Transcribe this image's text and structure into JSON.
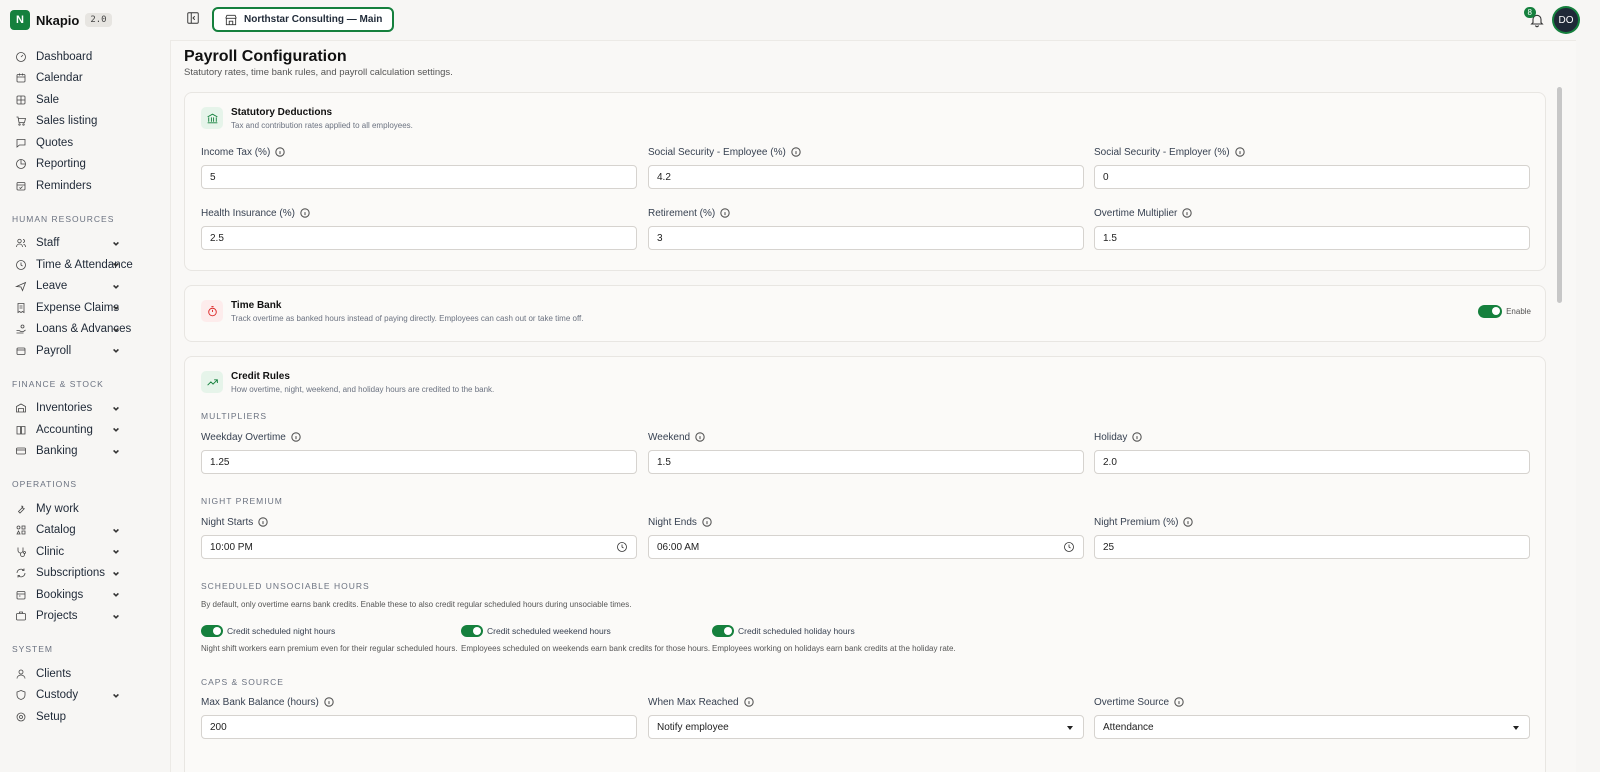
{
  "brand": {
    "name": "Nkapio",
    "version": "2.0"
  },
  "header": {
    "org": "Northstar Consulting — Main",
    "notif_count": "8",
    "avatar": "DO"
  },
  "nav": {
    "main": [
      {
        "label": "Dashboard",
        "icon": "gauge-icon"
      },
      {
        "label": "Calendar",
        "icon": "calendar-icon"
      },
      {
        "label": "Sale",
        "icon": "grid-icon"
      },
      {
        "label": "Sales listing",
        "icon": "cart-icon"
      },
      {
        "label": "Quotes",
        "icon": "message-icon"
      },
      {
        "label": "Reporting",
        "icon": "pie-icon"
      },
      {
        "label": "Reminders",
        "icon": "calendar-check-icon"
      }
    ],
    "hr_title": "HUMAN RESOURCES",
    "hr": [
      {
        "label": "Staff"
      },
      {
        "label": "Time & Attendance"
      },
      {
        "label": "Leave"
      },
      {
        "label": "Expense Claims"
      },
      {
        "label": "Loans & Advances"
      },
      {
        "label": "Payroll"
      }
    ],
    "fin_title": "FINANCE & STOCK",
    "fin": [
      {
        "label": "Inventories"
      },
      {
        "label": "Accounting"
      },
      {
        "label": "Banking"
      }
    ],
    "ops_title": "OPERATIONS",
    "ops": [
      {
        "label": "My work"
      },
      {
        "label": "Catalog"
      },
      {
        "label": "Clinic"
      },
      {
        "label": "Subscriptions"
      },
      {
        "label": "Bookings"
      },
      {
        "label": "Projects"
      }
    ],
    "sys_title": "SYSTEM",
    "sys": [
      {
        "label": "Clients"
      },
      {
        "label": "Custody"
      },
      {
        "label": "Setup"
      }
    ]
  },
  "page": {
    "title": "Payroll Configuration",
    "subtitle": "Statutory rates, time bank rules, and payroll calculation settings."
  },
  "statutory": {
    "title": "Statutory Deductions",
    "desc": "Tax and contribution rates applied to all employees.",
    "fields": [
      {
        "label": "Income Tax (%)",
        "value": "5"
      },
      {
        "label": "Social Security - Employee (%)",
        "value": "4.2"
      },
      {
        "label": "Social Security - Employer (%)",
        "value": "0"
      },
      {
        "label": "Health Insurance (%)",
        "value": "2.5"
      },
      {
        "label": "Retirement (%)",
        "value": "3"
      },
      {
        "label": "Overtime Multiplier",
        "value": "1.5"
      }
    ]
  },
  "timebank": {
    "title": "Time Bank",
    "desc": "Track overtime as banked hours instead of paying directly. Employees can cash out or take time off.",
    "toggle_label": "Enable"
  },
  "credit": {
    "title": "Credit Rules",
    "desc": "How overtime, night, weekend, and holiday hours are credited to the bank.",
    "multipliers_title": "MULTIPLIERS",
    "multipliers": [
      {
        "label": "Weekday Overtime",
        "value": "1.25"
      },
      {
        "label": "Weekend",
        "value": "1.5"
      },
      {
        "label": "Holiday",
        "value": "2.0"
      }
    ],
    "night_title": "NIGHT PREMIUM",
    "night": [
      {
        "label": "Night Starts",
        "value": "10:00 PM"
      },
      {
        "label": "Night Ends",
        "value": "06:00 AM"
      },
      {
        "label": "Night Premium (%)",
        "value": "25"
      }
    ],
    "unsociable_title": "SCHEDULED UNSOCIABLE HOURS",
    "unsociable_desc": "By default, only overtime earns bank credits. Enable these to also credit regular scheduled hours during unsociable times.",
    "toggles": [
      {
        "label": "Credit scheduled night hours",
        "desc": "Night shift workers earn premium even for their regular scheduled hours."
      },
      {
        "label": "Credit scheduled weekend hours",
        "desc": "Employees scheduled on weekends earn bank credits for those hours."
      },
      {
        "label": "Credit scheduled holiday hours",
        "desc": "Employees working on holidays earn bank credits at the holiday rate."
      }
    ],
    "caps_title": "CAPS & SOURCE",
    "caps": [
      {
        "label": "Max Bank Balance (hours)",
        "value": "200"
      },
      {
        "label": "When Max Reached",
        "value": "Notify employee"
      },
      {
        "label": "Overtime Source",
        "value": "Attendance"
      }
    ]
  }
}
